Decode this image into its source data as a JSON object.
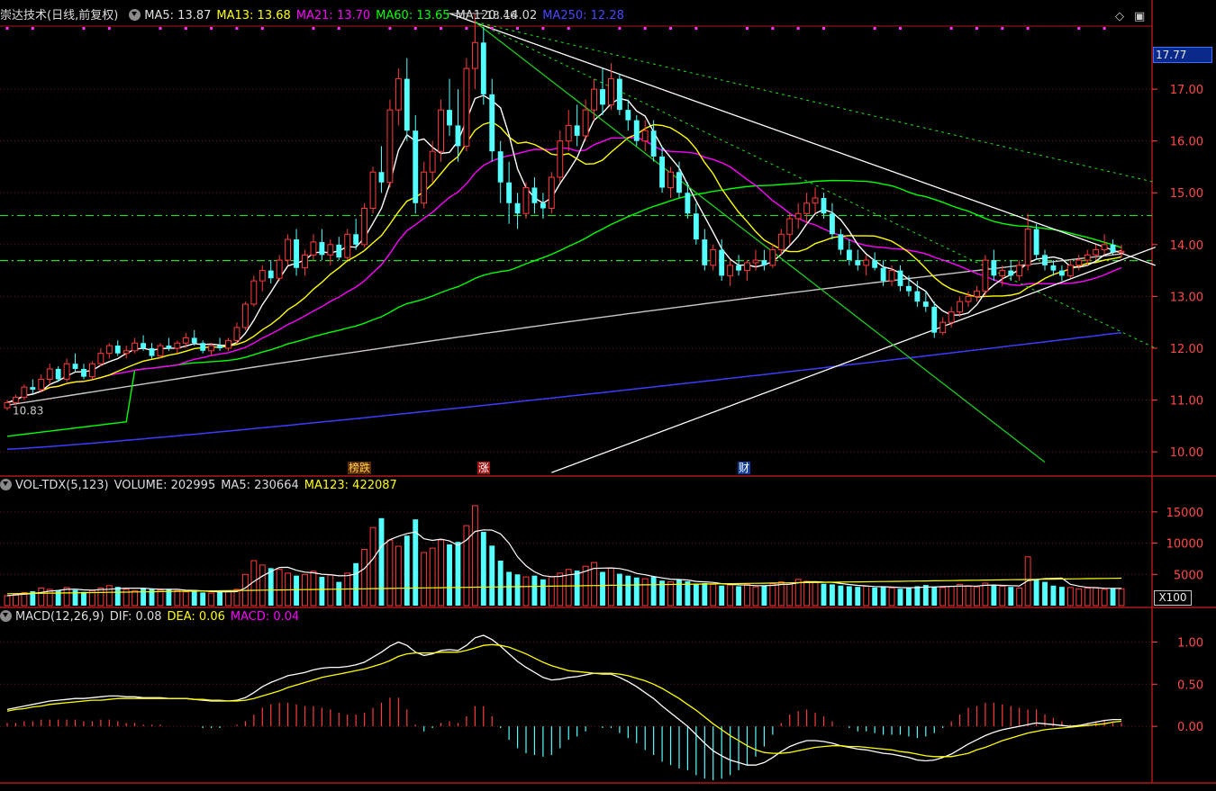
{
  "main_panel": {
    "legend": {
      "title": "崇达技术(日线,前复权)",
      "ma5": "MA5: 13.87",
      "ma13": "MA13: 13.68",
      "ma21": "MA21: 13.70",
      "ma60": "MA60: 13.65",
      "ma120": "MA120: 14.02",
      "ma250": "MA250: 12.28"
    },
    "y_axis_ticks": [
      "17.00",
      "16.00",
      "15.00",
      "14.00",
      "13.00",
      "12.00",
      "11.00",
      "10.00"
    ],
    "y_range": [
      9.55,
      18.2
    ],
    "current_price_box": "17.77",
    "high_marker": "18.46",
    "low_marker": "10.83",
    "event_tags": [
      {
        "text": "榜跌",
        "color": "#ffd24a",
        "bg": "#5a2a00"
      },
      {
        "text": "涨",
        "color": "#ffffff",
        "bg": "#a01010"
      },
      {
        "text": "财",
        "color": "#ffffff",
        "bg": "#0e3c9a"
      }
    ],
    "horizontal_levels": [
      14.56,
      13.69
    ]
  },
  "volume_panel": {
    "legend": {
      "title": "VOL-TDX(5,123)",
      "volume": "VOLUME: 202995",
      "ma5": "MA5: 230664",
      "ma123": "MA123: 422087"
    },
    "y_axis_ticks": [
      "15000",
      "10000",
      "5000"
    ],
    "unit_box": "X100"
  },
  "macd_panel": {
    "legend": {
      "title": "MACD(12,26,9)",
      "dif": "DIF: 0.08",
      "dea": "DEA: 0.06",
      "macd": "MACD: 0.04"
    },
    "y_axis_ticks": [
      "1.00",
      "0.50",
      "0.00"
    ]
  },
  "controls": {
    "diamond_icon": "◇",
    "window_icon": "▣"
  },
  "colors": {
    "up_candle": "#ff3b3b",
    "down_candle": "#54ffff",
    "ma5": "#ffffff",
    "ma13": "#ffff00",
    "ma21": "#ff00ff",
    "ma60": "#00ff00",
    "ma120": "#c8c8c8",
    "ma250": "#3c3cff",
    "panel_border": "#b01818",
    "grid": "#6e1414",
    "axis_text": "#ff4a4a"
  },
  "chart_data": [
    {
      "type": "candlestick",
      "title": "崇达技术(日线,前复权)",
      "note": "daily bars, approximate OHLC read from chart",
      "ylim": [
        9.55,
        18.2
      ],
      "ohlc": [
        [
          10.85,
          11.0,
          10.8,
          10.95
        ],
        [
          10.95,
          11.1,
          10.9,
          11.05
        ],
        [
          11.05,
          11.3,
          11.0,
          11.25
        ],
        [
          11.25,
          11.4,
          11.1,
          11.2
        ],
        [
          11.2,
          11.5,
          11.15,
          11.4
        ],
        [
          11.4,
          11.7,
          11.3,
          11.6
        ],
        [
          11.6,
          11.65,
          11.35,
          11.4
        ],
        [
          11.4,
          11.8,
          11.35,
          11.7
        ],
        [
          11.7,
          11.9,
          11.55,
          11.6
        ],
        [
          11.6,
          11.7,
          11.4,
          11.45
        ],
        [
          11.45,
          11.75,
          11.4,
          11.7
        ],
        [
          11.7,
          12.0,
          11.65,
          11.9
        ],
        [
          11.9,
          12.1,
          11.8,
          12.05
        ],
        [
          12.05,
          12.15,
          11.85,
          11.9
        ],
        [
          11.9,
          12.05,
          11.8,
          11.95
        ],
        [
          11.95,
          12.2,
          11.9,
          12.1
        ],
        [
          12.1,
          12.25,
          11.95,
          12.0
        ],
        [
          12.0,
          12.1,
          11.8,
          11.85
        ],
        [
          11.85,
          12.1,
          11.8,
          12.05
        ],
        [
          12.05,
          12.2,
          11.95,
          12.0
        ],
        [
          12.0,
          12.15,
          11.9,
          12.1
        ],
        [
          12.1,
          12.3,
          12.0,
          12.2
        ],
        [
          12.2,
          12.35,
          12.05,
          12.1
        ],
        [
          12.1,
          12.15,
          11.9,
          11.95
        ],
        [
          11.95,
          12.1,
          11.85,
          12.05
        ],
        [
          12.05,
          12.2,
          11.95,
          12.0
        ],
        [
          12.0,
          12.2,
          11.95,
          12.15
        ],
        [
          12.15,
          12.5,
          12.1,
          12.4
        ],
        [
          12.4,
          12.9,
          12.35,
          12.85
        ],
        [
          12.85,
          13.4,
          12.8,
          13.3
        ],
        [
          13.3,
          13.6,
          13.1,
          13.5
        ],
        [
          13.5,
          13.7,
          13.25,
          13.35
        ],
        [
          13.35,
          13.8,
          13.3,
          13.7
        ],
        [
          13.7,
          14.2,
          13.6,
          14.1
        ],
        [
          14.1,
          14.3,
          13.4,
          13.55
        ],
        [
          13.55,
          13.9,
          13.4,
          13.8
        ],
        [
          13.8,
          14.2,
          13.7,
          14.05
        ],
        [
          14.05,
          14.3,
          13.7,
          13.8
        ],
        [
          13.8,
          14.1,
          13.6,
          14.0
        ],
        [
          14.0,
          14.15,
          13.7,
          13.75
        ],
        [
          13.75,
          14.3,
          13.7,
          14.2
        ],
        [
          14.2,
          14.5,
          13.9,
          14.0
        ],
        [
          14.0,
          14.8,
          13.95,
          14.7
        ],
        [
          14.7,
          15.5,
          14.6,
          15.4
        ],
        [
          15.4,
          15.9,
          15.0,
          15.2
        ],
        [
          15.2,
          16.8,
          15.1,
          16.6
        ],
        [
          16.6,
          17.4,
          16.3,
          17.2
        ],
        [
          17.2,
          17.6,
          16.0,
          16.2
        ],
        [
          16.2,
          16.5,
          14.6,
          14.8
        ],
        [
          14.8,
          15.6,
          14.7,
          15.4
        ],
        [
          15.4,
          16.0,
          15.2,
          15.8
        ],
        [
          15.8,
          16.8,
          15.6,
          16.6
        ],
        [
          16.6,
          17.2,
          16.1,
          16.3
        ],
        [
          16.3,
          17.0,
          15.6,
          15.9
        ],
        [
          15.9,
          17.6,
          15.8,
          17.4
        ],
        [
          17.4,
          18.46,
          17.0,
          17.9
        ],
        [
          17.9,
          18.2,
          16.7,
          16.9
        ],
        [
          16.9,
          17.2,
          15.6,
          15.8
        ],
        [
          15.8,
          16.0,
          14.8,
          15.2
        ],
        [
          15.2,
          15.6,
          14.4,
          14.8
        ],
        [
          14.8,
          15.0,
          14.3,
          14.6
        ],
        [
          14.6,
          15.2,
          14.5,
          15.1
        ],
        [
          15.1,
          15.3,
          14.6,
          14.8
        ],
        [
          14.8,
          15.0,
          14.5,
          14.7
        ],
        [
          14.7,
          15.4,
          14.6,
          15.3
        ],
        [
          15.3,
          16.2,
          15.2,
          16.0
        ],
        [
          16.0,
          16.6,
          15.8,
          16.3
        ],
        [
          16.3,
          16.7,
          15.9,
          16.1
        ],
        [
          16.1,
          16.8,
          16.0,
          16.6
        ],
        [
          16.6,
          17.2,
          16.4,
          17.0
        ],
        [
          17.0,
          17.4,
          16.5,
          16.7
        ],
        [
          16.7,
          17.5,
          16.6,
          17.2
        ],
        [
          17.2,
          17.3,
          16.5,
          16.6
        ],
        [
          16.6,
          16.8,
          16.2,
          16.4
        ],
        [
          16.4,
          16.5,
          15.9,
          16.0
        ],
        [
          16.0,
          16.4,
          15.8,
          16.2
        ],
        [
          16.2,
          16.4,
          15.6,
          15.7
        ],
        [
          15.7,
          15.9,
          15.0,
          15.1
        ],
        [
          15.1,
          15.5,
          14.9,
          15.4
        ],
        [
          15.4,
          15.6,
          14.9,
          15.0
        ],
        [
          15.0,
          15.2,
          14.5,
          14.6
        ],
        [
          14.6,
          14.8,
          14.0,
          14.1
        ],
        [
          14.1,
          14.3,
          13.5,
          13.6
        ],
        [
          13.6,
          14.0,
          13.5,
          13.9
        ],
        [
          13.9,
          14.1,
          13.3,
          13.4
        ],
        [
          13.4,
          13.7,
          13.2,
          13.6
        ],
        [
          13.6,
          13.8,
          13.4,
          13.5
        ],
        [
          13.5,
          13.7,
          13.3,
          13.65
        ],
        [
          13.65,
          13.9,
          13.5,
          13.7
        ],
        [
          13.7,
          13.9,
          13.5,
          13.6
        ],
        [
          13.6,
          14.0,
          13.55,
          13.9
        ],
        [
          13.9,
          14.3,
          13.8,
          14.2
        ],
        [
          14.2,
          14.6,
          14.0,
          14.5
        ],
        [
          14.5,
          14.8,
          14.3,
          14.6
        ],
        [
          14.6,
          15.0,
          14.4,
          14.8
        ],
        [
          14.8,
          15.1,
          14.6,
          14.9
        ],
        [
          14.9,
          15.0,
          14.5,
          14.6
        ],
        [
          14.6,
          14.8,
          14.1,
          14.2
        ],
        [
          14.2,
          14.3,
          13.8,
          13.9
        ],
        [
          13.9,
          14.1,
          13.6,
          13.7
        ],
        [
          13.7,
          13.9,
          13.5,
          13.6
        ],
        [
          13.6,
          13.8,
          13.4,
          13.7
        ],
        [
          13.7,
          13.85,
          13.5,
          13.55
        ],
        [
          13.55,
          13.7,
          13.2,
          13.3
        ],
        [
          13.3,
          13.6,
          13.2,
          13.5
        ],
        [
          13.5,
          13.6,
          13.1,
          13.2
        ],
        [
          13.2,
          13.4,
          13.0,
          13.1
        ],
        [
          13.1,
          13.3,
          12.8,
          12.9
        ],
        [
          12.9,
          13.1,
          12.7,
          12.8
        ],
        [
          12.8,
          12.9,
          12.2,
          12.3
        ],
        [
          12.3,
          12.6,
          12.25,
          12.5
        ],
        [
          12.5,
          12.8,
          12.4,
          12.7
        ],
        [
          12.7,
          13.0,
          12.6,
          12.9
        ],
        [
          12.9,
          13.1,
          12.8,
          13.0
        ],
        [
          13.0,
          13.2,
          12.9,
          13.1
        ],
        [
          13.1,
          13.8,
          13.0,
          13.7
        ],
        [
          13.7,
          13.9,
          13.3,
          13.4
        ],
        [
          13.4,
          13.6,
          13.2,
          13.5
        ],
        [
          13.5,
          13.7,
          13.3,
          13.4
        ],
        [
          13.4,
          13.7,
          13.3,
          13.6
        ],
        [
          13.6,
          14.6,
          13.5,
          14.3
        ],
        [
          14.3,
          14.4,
          13.7,
          13.8
        ],
        [
          13.8,
          13.9,
          13.5,
          13.6
        ],
        [
          13.6,
          13.7,
          13.4,
          13.5
        ],
        [
          13.5,
          13.6,
          13.3,
          13.4
        ],
        [
          13.4,
          13.7,
          13.35,
          13.6
        ],
        [
          13.6,
          13.8,
          13.5,
          13.7
        ],
        [
          13.7,
          13.9,
          13.6,
          13.8
        ],
        [
          13.8,
          14.0,
          13.7,
          13.9
        ],
        [
          13.9,
          14.2,
          13.8,
          14.0
        ],
        [
          14.0,
          14.1,
          13.8,
          13.85
        ],
        [
          13.85,
          14.0,
          13.75,
          13.87
        ]
      ]
    },
    {
      "type": "bar",
      "title": "VOL-TDX(5,123)",
      "unit": "X100",
      "ylim": [
        0,
        18000
      ],
      "values": [
        1600,
        1800,
        2100,
        2300,
        2800,
        2600,
        2400,
        2900,
        2500,
        2200,
        2400,
        2800,
        3200,
        3000,
        2600,
        2400,
        2800,
        2700,
        2500,
        2600,
        2400,
        2200,
        2500,
        2100,
        2000,
        2200,
        2300,
        2600,
        5000,
        7200,
        6500,
        6000,
        5800,
        5200,
        4800,
        5000,
        5500,
        4600,
        4900,
        3800,
        5200,
        6800,
        9000,
        12500,
        14000,
        10500,
        9500,
        11200,
        13800,
        8500,
        9200,
        10500,
        9800,
        10200,
        12800,
        16000,
        11800,
        9600,
        7200,
        5400,
        5000,
        4600,
        4800,
        4200,
        4600,
        5200,
        5800,
        5600,
        6300,
        6900,
        5400,
        6000,
        5100,
        4800,
        4500,
        4300,
        4600,
        4000,
        3800,
        4200,
        3900,
        3500,
        3600,
        3400,
        3200,
        3300,
        3100,
        3400,
        3000,
        3200,
        3500,
        3800,
        3600,
        4200,
        3900,
        3700,
        3500,
        3400,
        3200,
        3100,
        3000,
        3100,
        2900,
        3000,
        2800,
        2700,
        2900,
        3100,
        3300,
        3000,
        2900,
        3100,
        3400,
        3200,
        3000,
        3600,
        3300,
        3100,
        3000,
        2800,
        7800,
        4200,
        3800,
        3200,
        3000,
        2900,
        2700,
        2800,
        2900,
        2600,
        2800,
        2700
      ]
    },
    {
      "type": "bar",
      "title": "MACD(12,26,9)",
      "ylim": [
        -0.65,
        1.4
      ],
      "dif": [
        0.2,
        0.22,
        0.24,
        0.26,
        0.28,
        0.3,
        0.31,
        0.32,
        0.33,
        0.33,
        0.34,
        0.35,
        0.36,
        0.36,
        0.35,
        0.35,
        0.34,
        0.34,
        0.34,
        0.33,
        0.33,
        0.33,
        0.32,
        0.31,
        0.3,
        0.3,
        0.3,
        0.31,
        0.34,
        0.4,
        0.47,
        0.52,
        0.56,
        0.6,
        0.62,
        0.64,
        0.67,
        0.69,
        0.7,
        0.7,
        0.71,
        0.73,
        0.76,
        0.82,
        0.88,
        0.95,
        1.0,
        0.96,
        0.88,
        0.84,
        0.86,
        0.9,
        0.91,
        0.9,
        0.96,
        1.05,
        1.08,
        1.03,
        0.95,
        0.86,
        0.77,
        0.7,
        0.64,
        0.58,
        0.55,
        0.56,
        0.58,
        0.59,
        0.61,
        0.63,
        0.62,
        0.62,
        0.58,
        0.53,
        0.47,
        0.4,
        0.33,
        0.24,
        0.16,
        0.08,
        0.0,
        -0.1,
        -0.2,
        -0.29,
        -0.35,
        -0.4,
        -0.43,
        -0.46,
        -0.46,
        -0.43,
        -0.37,
        -0.3,
        -0.24,
        -0.2,
        -0.17,
        -0.17,
        -0.18,
        -0.2,
        -0.23,
        -0.25,
        -0.27,
        -0.28,
        -0.3,
        -0.32,
        -0.33,
        -0.35,
        -0.37,
        -0.4,
        -0.41,
        -0.4,
        -0.37,
        -0.33,
        -0.27,
        -0.21,
        -0.16,
        -0.11,
        -0.07,
        -0.04,
        -0.02,
        0.0,
        0.02,
        0.04,
        0.03,
        0.02,
        0.01,
        0.0,
        0.01,
        0.03,
        0.05,
        0.07,
        0.08,
        0.08
      ],
      "dea": [
        0.18,
        0.2,
        0.21,
        0.23,
        0.24,
        0.26,
        0.27,
        0.28,
        0.29,
        0.3,
        0.31,
        0.31,
        0.32,
        0.33,
        0.33,
        0.33,
        0.33,
        0.33,
        0.33,
        0.33,
        0.33,
        0.33,
        0.32,
        0.32,
        0.31,
        0.31,
        0.3,
        0.3,
        0.31,
        0.33,
        0.36,
        0.39,
        0.42,
        0.46,
        0.49,
        0.52,
        0.55,
        0.58,
        0.6,
        0.62,
        0.64,
        0.66,
        0.68,
        0.71,
        0.74,
        0.78,
        0.83,
        0.86,
        0.87,
        0.87,
        0.87,
        0.88,
        0.88,
        0.88,
        0.9,
        0.93,
        0.96,
        0.97,
        0.96,
        0.94,
        0.9,
        0.86,
        0.81,
        0.76,
        0.72,
        0.69,
        0.66,
        0.65,
        0.64,
        0.63,
        0.63,
        0.63,
        0.62,
        0.6,
        0.57,
        0.54,
        0.5,
        0.45,
        0.39,
        0.33,
        0.26,
        0.19,
        0.11,
        0.03,
        -0.04,
        -0.11,
        -0.17,
        -0.23,
        -0.28,
        -0.31,
        -0.32,
        -0.32,
        -0.31,
        -0.29,
        -0.27,
        -0.25,
        -0.24,
        -0.23,
        -0.23,
        -0.24,
        -0.24,
        -0.25,
        -0.26,
        -0.27,
        -0.28,
        -0.3,
        -0.31,
        -0.33,
        -0.35,
        -0.36,
        -0.36,
        -0.36,
        -0.34,
        -0.32,
        -0.28,
        -0.25,
        -0.21,
        -0.17,
        -0.14,
        -0.11,
        -0.08,
        -0.06,
        -0.04,
        -0.03,
        -0.02,
        -0.01,
        0.0,
        0.01,
        0.02,
        0.03,
        0.05,
        0.06
      ]
    }
  ]
}
